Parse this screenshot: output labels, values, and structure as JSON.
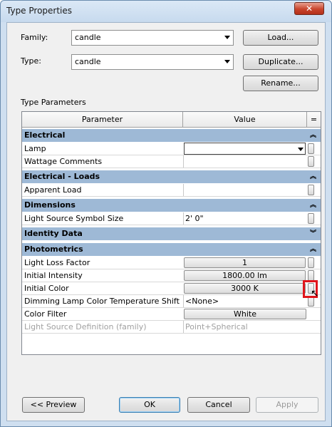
{
  "window": {
    "title": "Type Properties",
    "close_glyph": "✕"
  },
  "family": {
    "label": "Family:",
    "value": "candle"
  },
  "type": {
    "label": "Type:",
    "value": "candle"
  },
  "buttons": {
    "load": "Load...",
    "duplicate": "Duplicate...",
    "rename": "Rename..."
  },
  "section_label": "Type Parameters",
  "grid": {
    "col_parameter": "Parameter",
    "col_value": "Value",
    "col_extra": "=",
    "groups": {
      "electrical": "Electrical",
      "electrical_loads": "Electrical - Loads",
      "dimensions": "Dimensions",
      "identity": "Identity Data",
      "photometrics": "Photometrics"
    },
    "rows": {
      "lamp": {
        "name": "Lamp",
        "value": ""
      },
      "wattage": {
        "name": "Wattage Comments",
        "value": ""
      },
      "apparent_load": {
        "name": "Apparent Load",
        "value": ""
      },
      "symbol_size": {
        "name": "Light Source Symbol Size",
        "value": "2'  0\""
      },
      "loss_factor": {
        "name": "Light Loss Factor",
        "value": "1"
      },
      "intensity": {
        "name": "Initial Intensity",
        "value": "1800.00 lm"
      },
      "color": {
        "name": "Initial Color",
        "value": "3000 K"
      },
      "dimming": {
        "name": "Dimming Lamp Color Temperature Shift",
        "value": "<None>"
      },
      "filter": {
        "name": "Color Filter",
        "value": "White"
      },
      "definition": {
        "name": "Light Source Definition (family)",
        "value": "Point+Spherical"
      }
    }
  },
  "footer": {
    "preview": "<< Preview",
    "ok": "OK",
    "cancel": "Cancel",
    "apply": "Apply"
  },
  "colors": {
    "group_header": "#9eb9d6",
    "highlight": "#e0151b"
  }
}
